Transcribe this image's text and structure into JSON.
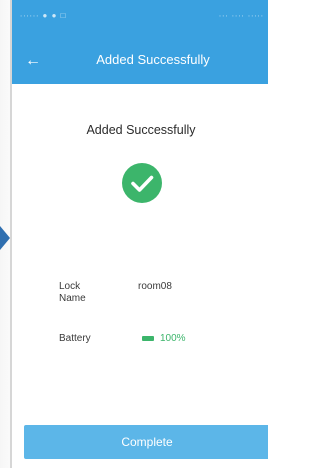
{
  "status_bar": {
    "left_text": "∙∙∙∙∙∙ ● ● □",
    "right_text": "∙∙∙ ∙∙∙∙ ∙∙∙∙∙"
  },
  "nav": {
    "back_icon": "←",
    "title": "Added Successfully"
  },
  "main": {
    "headline": "Added Successfully",
    "success_icon": "checkmark-circle",
    "success_color": "#3cb56b"
  },
  "info": {
    "lock_name_label": "Lock Name",
    "lock_name_value": "room08",
    "battery_label": "Battery",
    "battery_value": "100%",
    "battery_level": 1.0
  },
  "actions": {
    "complete_label": "Complete"
  },
  "colors": {
    "primary": "#3aa1e0",
    "button": "#5cb6e8",
    "success": "#3cb56b"
  }
}
